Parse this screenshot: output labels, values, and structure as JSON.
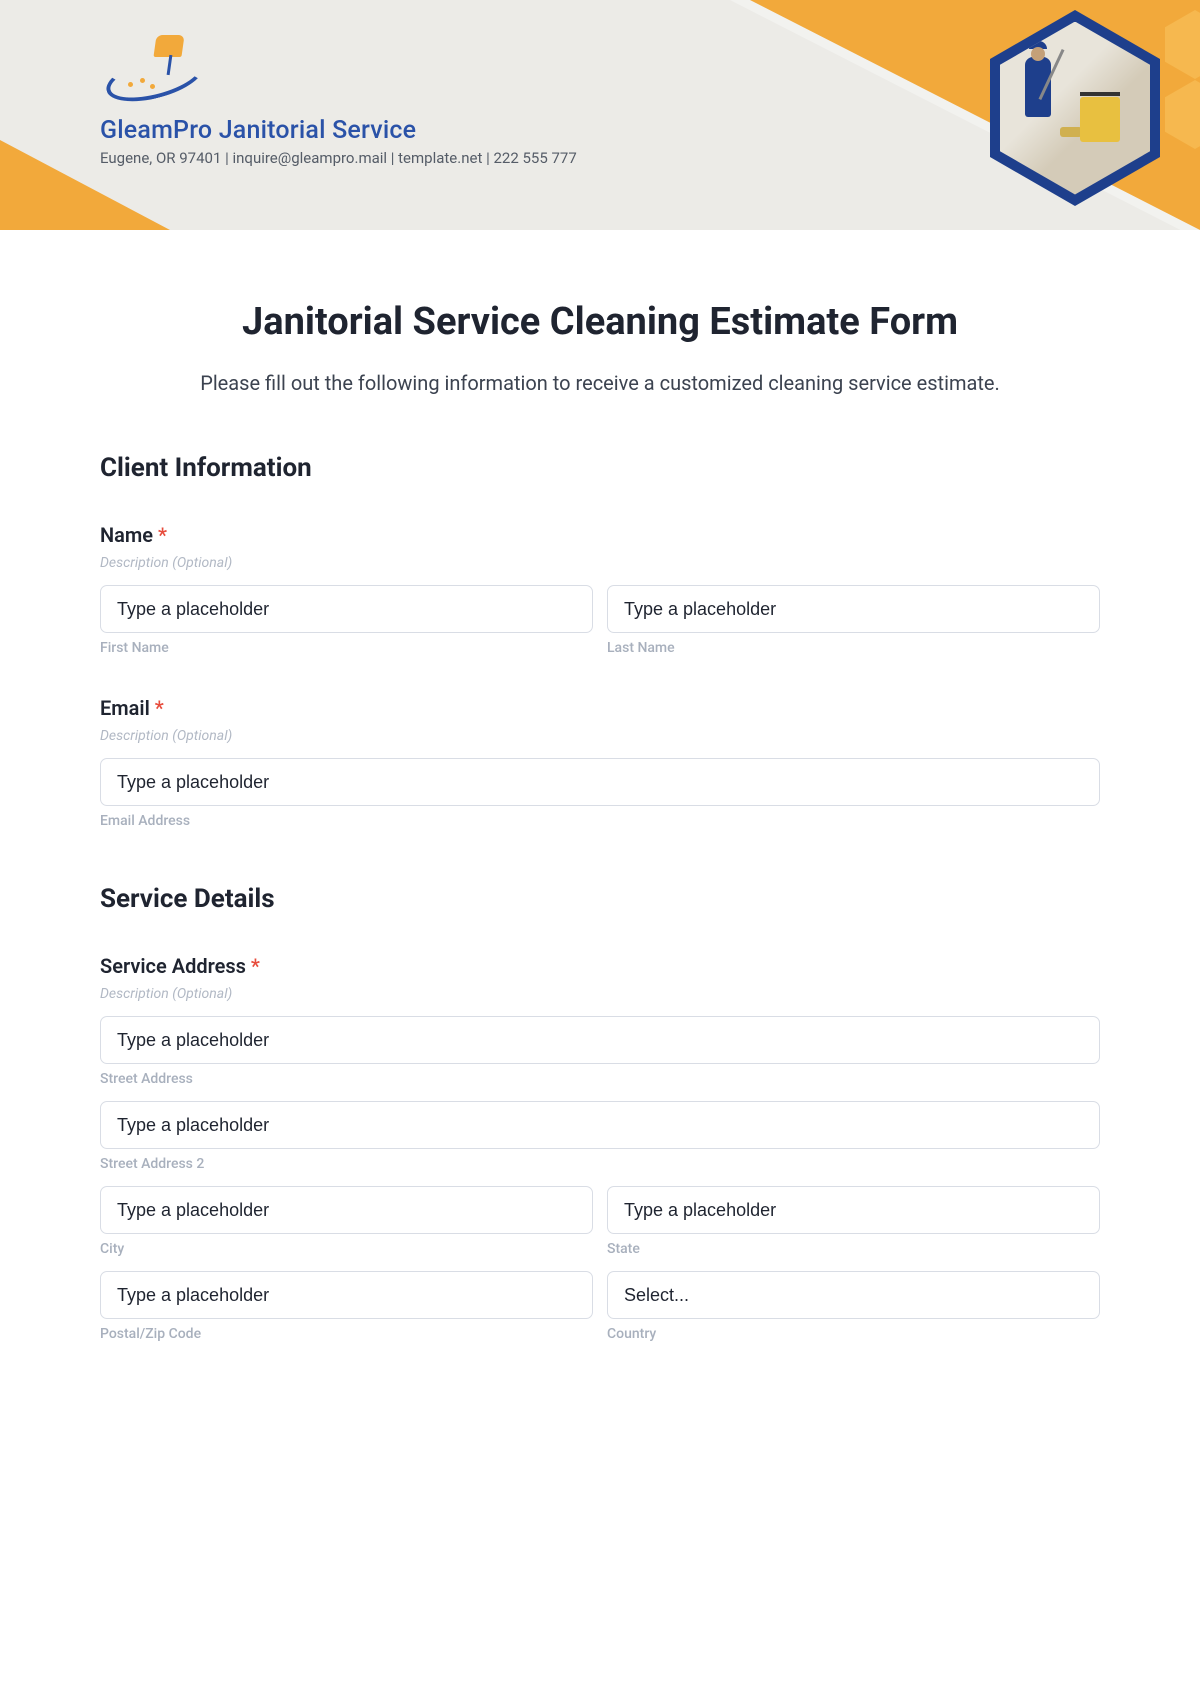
{
  "header": {
    "company_name": "GleamPro Janitorial Service",
    "company_info": "Eugene, OR 97401 | inquire@gleampro.mail | template.net | 222 555 777"
  },
  "form": {
    "title": "Janitorial Service Cleaning Estimate Form",
    "subtitle": "Please fill out the following information to receive a customized cleaning service estimate.",
    "section1_title": "Client Information",
    "section2_title": "Service Details",
    "name_label": "Name",
    "email_label": "Email",
    "address_label": "Service Address",
    "required": "*",
    "desc_placeholder": "Description (Optional)",
    "input_placeholder": "Type a placeholder",
    "select_placeholder": "Select...",
    "sublabels": {
      "first_name": "First Name",
      "last_name": "Last Name",
      "email_address": "Email Address",
      "street": "Street Address",
      "street2": "Street Address 2",
      "city": "City",
      "state": "State",
      "postal": "Postal/Zip Code",
      "country": "Country"
    }
  }
}
